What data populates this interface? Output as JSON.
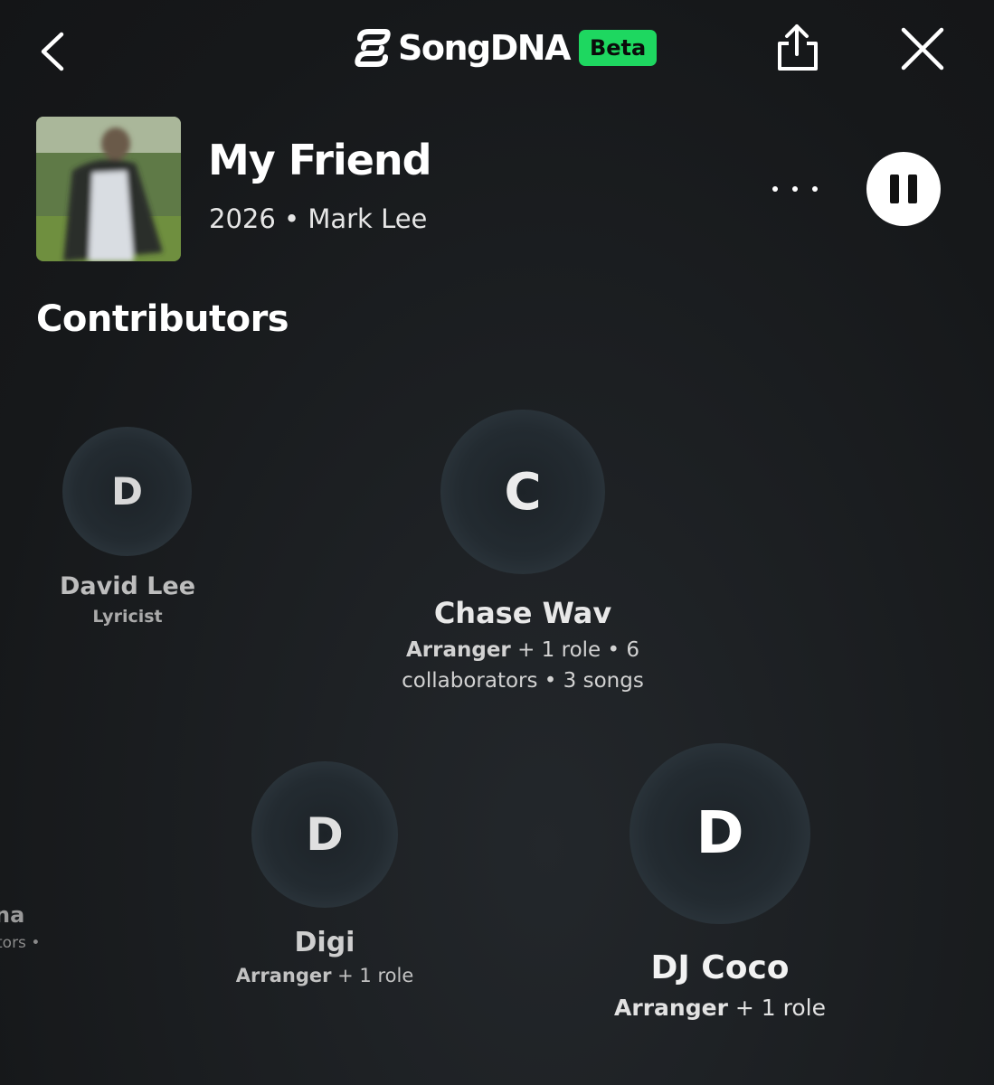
{
  "header": {
    "app_name": "SongDNA",
    "beta_label": "Beta",
    "icons": [
      "back-chevron-icon",
      "songdna-logo-icon",
      "share-icon",
      "close-icon"
    ]
  },
  "track": {
    "title": "My Friend",
    "meta": "2026 • Mark Lee"
  },
  "section": {
    "title": "Contributors"
  },
  "contributors": [
    {
      "initial": "D",
      "name": "David Lee",
      "role": "Lyricist",
      "extra": ""
    },
    {
      "initial": "C",
      "name": "Chase Wav",
      "role": "Arranger",
      "extra": " + 1 role • 6",
      "extra2": "collaborators • 3 songs"
    },
    {
      "initial": "D",
      "name": "Digi",
      "role": "Arranger",
      "extra": " + 1 role"
    },
    {
      "initial": "D",
      "name": "DJ Coco",
      "role": "Arranger",
      "extra": " + 1 role"
    },
    {
      "initial": "",
      "name": "na",
      "role": "",
      "extra": "tors •"
    }
  ],
  "colors": {
    "accent": "#1ed760",
    "background": "#17191b",
    "bubble": "#232b31"
  }
}
